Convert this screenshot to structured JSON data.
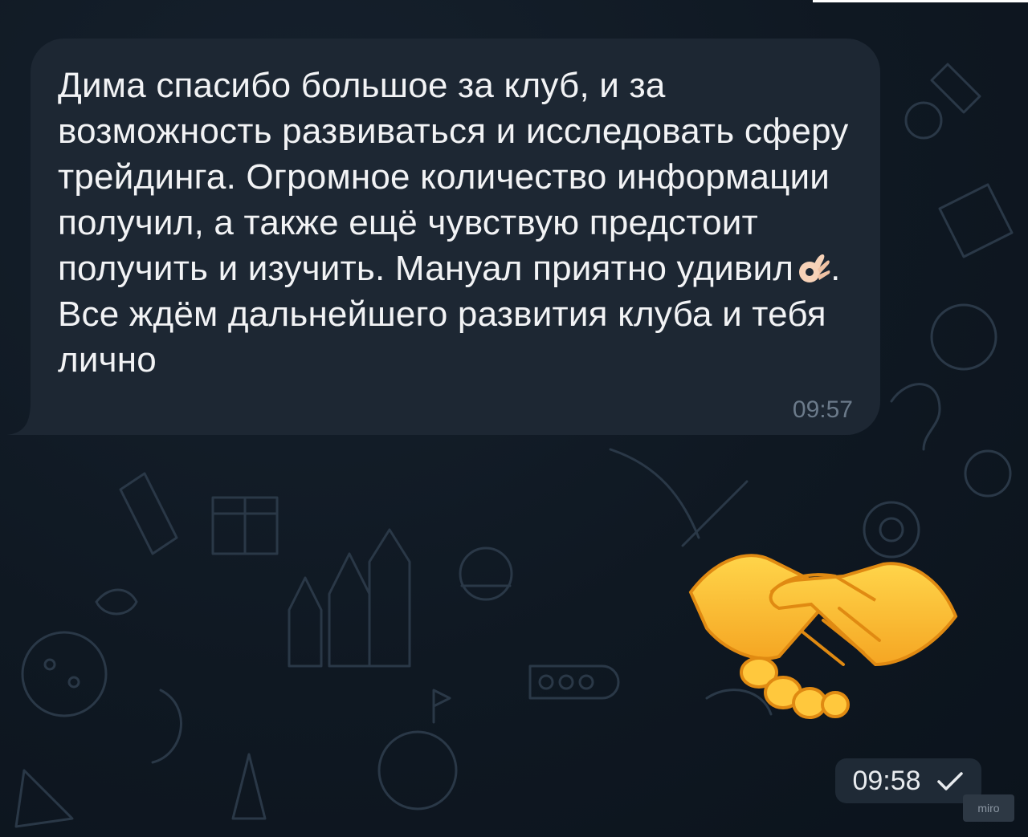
{
  "messages": [
    {
      "direction": "incoming",
      "text_before_emoji": "Дима спасибо большое за клуб, и за возможность развиваться и исследовать сферу трейдинга. Огромное количество информации получил, а также ещё чувствую предстоит получить и изучить. Мануал приятно удивил",
      "emoji": "ok-hand-icon",
      "text_after_emoji": ". Все ждём дальнейшего развития клуба и тебя лично",
      "time": "09:57"
    },
    {
      "direction": "outgoing",
      "sticker": "handshake-icon",
      "time": "09:58",
      "status": "check-icon"
    }
  ],
  "watermark": "miro",
  "colors": {
    "background": "#0e1621",
    "incoming_bubble": "#1d2733",
    "time_pill": "#1f2a36",
    "sticker_yellow": "#ffc83d"
  }
}
